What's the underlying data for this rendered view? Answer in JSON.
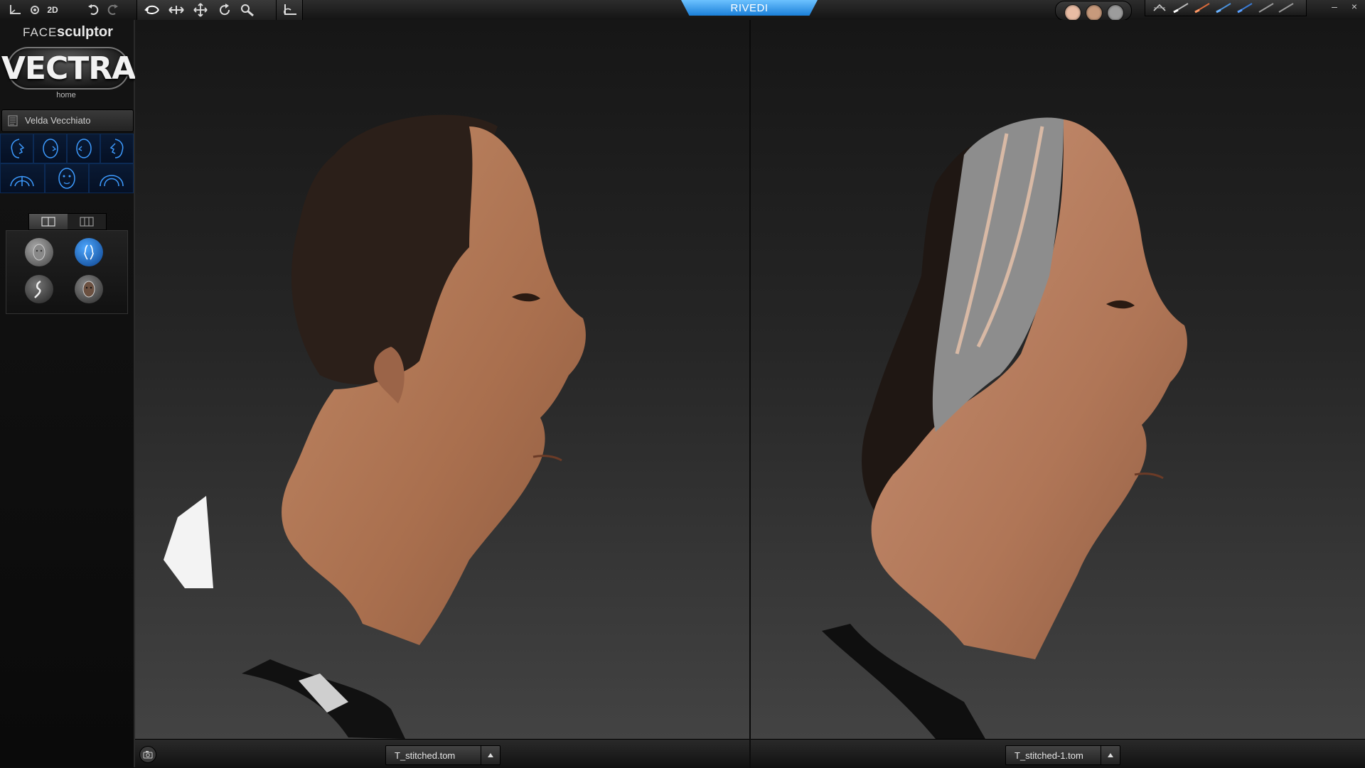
{
  "toolbar": {
    "view_2d_label": "2D",
    "tools": [
      "rotate-icon",
      "pan-horizontal-icon",
      "move-icon",
      "refresh-icon",
      "zoom-icon"
    ],
    "reset_tool": "axis-reset-icon",
    "active_tab": "RIVEDI",
    "texture_swatches": [
      "#e8bca4",
      "#c79a7c",
      "#9c9c9c"
    ],
    "brush_icons": [
      "brush-icon",
      "brush-icon",
      "brush-icon",
      "brush-icon",
      "brush-icon",
      "brush-icon",
      "brush-icon"
    ],
    "minimize": "–",
    "close": "×"
  },
  "sidebar": {
    "brand_face": "FACE",
    "brand_sculptor": "sculptor",
    "logo_text": "VECTRA",
    "home_label": "home",
    "patient_name": "Velda Vecchiato",
    "view_presets_row1": [
      "right-profile-view-icon",
      "right-oblique-view-icon",
      "left-oblique-view-icon",
      "left-profile-view-icon"
    ],
    "view_presets_row2": [
      "bottom-view-icon",
      "frontal-view-icon",
      "top-view-icon"
    ],
    "modes": [
      "face-surface-mode-icon",
      "profile-compare-mode-icon",
      "profile-silhouette-mode-icon",
      "face-texture-mode-icon"
    ]
  },
  "viewports": {
    "left_file": "T_stitched.tom",
    "right_file": "T_stitched-1.tom"
  },
  "colors": {
    "accent_blue": "#1b7fd8",
    "skin_tone": "#b57c5a",
    "hair": "#2a1e19"
  }
}
